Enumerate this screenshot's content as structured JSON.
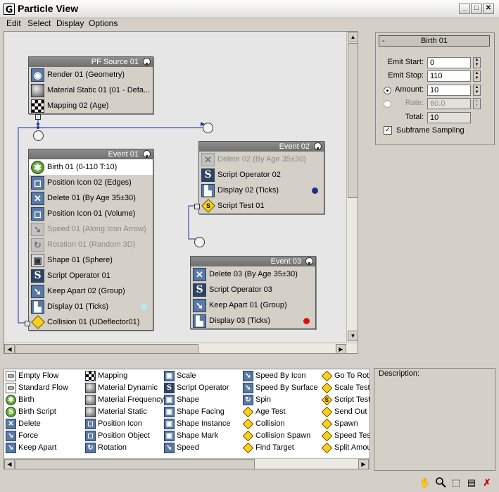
{
  "window": {
    "title": "Particle View"
  },
  "menu": [
    "Edit",
    "Select",
    "Display",
    "Options"
  ],
  "nodes": {
    "pf_source": {
      "title": "PF Source 01",
      "ops": [
        {
          "label": "Render 01 (Geometry)",
          "icon": "render-icon",
          "glyph": "◉"
        },
        {
          "label": "Material Static 01 (01 - Defa...",
          "icon": "material-icon",
          "glyph": ""
        },
        {
          "label": "Mapping 02 (Age)",
          "icon": "mapping-icon",
          "glyph": "▚"
        }
      ]
    },
    "event01": {
      "title": "Event 01",
      "ops": [
        {
          "label": "Birth 01 (0-110 T:10)",
          "icon": "birth-icon",
          "glyph": "✱"
        },
        {
          "label": "Position Icon 02 (Edges)",
          "icon": "position-icon-icon",
          "glyph": "◻"
        },
        {
          "label": "Delete 01 (By Age 35±30)",
          "icon": "delete-icon",
          "glyph": "✕"
        },
        {
          "label": "Position Icon 01 (Volume)",
          "icon": "position-icon-icon",
          "glyph": "◻"
        },
        {
          "label": "Speed 01 (Along Icon Arrow)",
          "icon": "speed-icon",
          "glyph": "➘"
        },
        {
          "label": "Rotation 01 (Random 3D)",
          "icon": "rotation-icon",
          "glyph": "↻"
        },
        {
          "label": "Shape 01 (Sphere)",
          "icon": "shape-icon",
          "glyph": "▣"
        },
        {
          "label": "Script Operator 01",
          "icon": "script-icon",
          "glyph": "S"
        },
        {
          "label": "Keep Apart 02 (Group)",
          "icon": "keep-apart-icon",
          "glyph": "➘"
        },
        {
          "label": "Display 01 (Ticks)",
          "icon": "display-icon",
          "glyph": "▙"
        },
        {
          "label": "Collision 01 (UDeflector01)",
          "icon": "collision-test-icon",
          "glyph": "⚡"
        }
      ],
      "display_color": "#b3ecf2"
    },
    "event02": {
      "title": "Event 02",
      "ops": [
        {
          "label": "Delete 02 (By Age 35±30)",
          "icon": "delete-icon",
          "glyph": "✕"
        },
        {
          "label": "Script Operator 02",
          "icon": "script-icon",
          "glyph": "S"
        },
        {
          "label": "Display 02 (Ticks)",
          "icon": "display-icon",
          "glyph": "▙"
        },
        {
          "label": "Script Test 01",
          "icon": "script-test-icon",
          "glyph": "S"
        }
      ],
      "display_color": "#1c2f8c"
    },
    "event03": {
      "title": "Event 03",
      "ops": [
        {
          "label": "Delete 03 (By Age 35±30)",
          "icon": "delete-icon",
          "glyph": "✕"
        },
        {
          "label": "Script Operator 03",
          "icon": "script-icon",
          "glyph": "S"
        },
        {
          "label": "Keep Apart 01 (Group)",
          "icon": "keep-apart-icon",
          "glyph": "➘"
        },
        {
          "label": "Display 03 (Ticks)",
          "icon": "display-icon",
          "glyph": "▙"
        }
      ],
      "display_color": "#e01010"
    }
  },
  "rollout": {
    "title": "Birth 01",
    "collapse_glyph": "-",
    "emit_start": {
      "label": "Emit Start:",
      "value": "0"
    },
    "emit_stop": {
      "label": "Emit Stop:",
      "value": "110"
    },
    "amount": {
      "label": "Amount:",
      "value": "10"
    },
    "rate": {
      "label": "Rate:",
      "value": "60.0"
    },
    "total": {
      "label": "Total:",
      "value": "10"
    },
    "subframe": {
      "label": "Subframe Sampling",
      "checked": true
    }
  },
  "depot": {
    "columns": [
      [
        {
          "label": "Empty Flow",
          "icon": "empty-flow-icon",
          "glyph": "▭"
        },
        {
          "label": "Standard Flow",
          "icon": "standard-flow-icon",
          "glyph": "▭"
        },
        {
          "label": "Birth",
          "icon": "birth-icon",
          "glyph": "✱"
        },
        {
          "label": "Birth Script",
          "icon": "birth-script-icon",
          "glyph": "S"
        },
        {
          "label": "Delete",
          "icon": "delete-icon",
          "glyph": "✕"
        },
        {
          "label": "Force",
          "icon": "force-icon",
          "glyph": "➘"
        },
        {
          "label": "Keep Apart",
          "icon": "keep-apart-icon",
          "glyph": "➘"
        }
      ],
      [
        {
          "label": "Mapping",
          "icon": "mapping-icon",
          "glyph": ""
        },
        {
          "label": "Material Dynamic",
          "icon": "material-dynamic-icon",
          "glyph": ""
        },
        {
          "label": "Material Frequency",
          "icon": "material-frequency-icon",
          "glyph": ""
        },
        {
          "label": "Material Static",
          "icon": "material-static-icon",
          "glyph": ""
        },
        {
          "label": "Position Icon",
          "icon": "position-icon-icon",
          "glyph": "◻"
        },
        {
          "label": "Position Object",
          "icon": "position-object-icon",
          "glyph": "◻"
        },
        {
          "label": "Rotation",
          "icon": "rotation-icon",
          "glyph": "↻"
        }
      ],
      [
        {
          "label": "Scale",
          "icon": "scale-icon",
          "glyph": "▣"
        },
        {
          "label": "Script Operator",
          "icon": "script-operator-icon",
          "glyph": "S"
        },
        {
          "label": "Shape",
          "icon": "shape-icon",
          "glyph": "▣"
        },
        {
          "label": "Shape Facing",
          "icon": "shape-facing-icon",
          "glyph": "▣"
        },
        {
          "label": "Shape Instance",
          "icon": "shape-instance-icon",
          "glyph": "▣"
        },
        {
          "label": "Shape Mark",
          "icon": "shape-mark-icon",
          "glyph": "▣"
        },
        {
          "label": "Speed",
          "icon": "speed-icon",
          "glyph": "➘"
        }
      ],
      [
        {
          "label": "Speed By Icon",
          "icon": "speed-by-icon-icon",
          "glyph": "➘"
        },
        {
          "label": "Speed By Surface",
          "icon": "speed-by-surface-icon",
          "glyph": "➘"
        },
        {
          "label": "Spin",
          "icon": "spin-icon",
          "glyph": "↻"
        },
        {
          "label": "Age Test",
          "icon": "age-test-icon",
          "glyph": "⚡"
        },
        {
          "label": "Collision",
          "icon": "collision-icon",
          "glyph": "⚡"
        },
        {
          "label": "Collision Spawn",
          "icon": "collision-spawn-icon",
          "glyph": "⚡"
        },
        {
          "label": "Find Target",
          "icon": "find-target-icon",
          "glyph": "⚡"
        }
      ],
      [
        {
          "label": "Go To Rot",
          "icon": "go-to-rotation-icon",
          "glyph": "⚡"
        },
        {
          "label": "Scale Test",
          "icon": "scale-test-icon",
          "glyph": "⚡"
        },
        {
          "label": "Script Test",
          "icon": "script-test-icon",
          "glyph": "S"
        },
        {
          "label": "Send Out",
          "icon": "send-out-icon",
          "glyph": "⚡"
        },
        {
          "label": "Spawn",
          "icon": "spawn-icon",
          "glyph": "⚡"
        },
        {
          "label": "Speed Tes",
          "icon": "speed-test-icon",
          "glyph": "⚡"
        },
        {
          "label": "Split Amoun",
          "icon": "split-amount-icon",
          "glyph": "⚡"
        }
      ]
    ]
  },
  "description": {
    "label": "Description:"
  },
  "toolbar": [
    {
      "icon": "pan-hand-icon",
      "glyph": "✋"
    },
    {
      "icon": "zoom-icon",
      "glyph": "🔍"
    },
    {
      "icon": "zoom-region-icon",
      "glyph": "⬚"
    },
    {
      "icon": "zoom-extents-icon",
      "glyph": "▤"
    },
    {
      "icon": "no-wiring-icon",
      "glyph": "✗"
    }
  ]
}
